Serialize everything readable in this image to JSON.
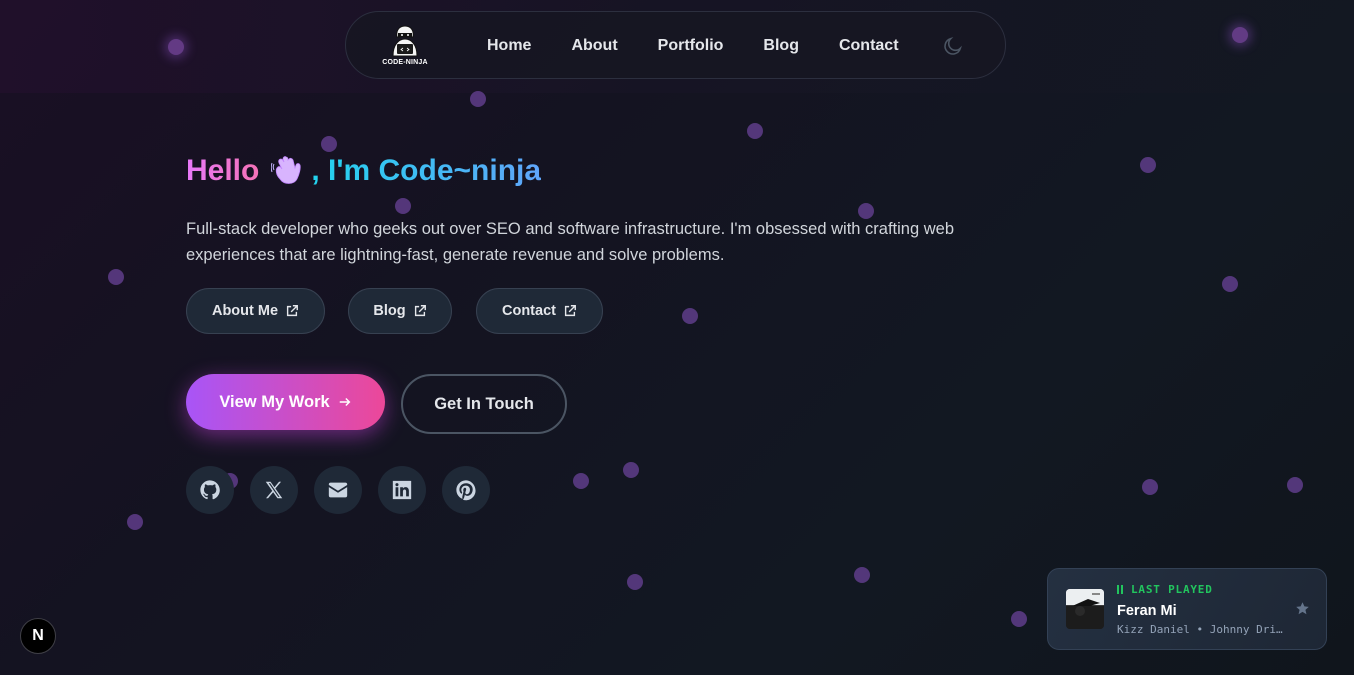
{
  "nav": {
    "logo_text": "CODE-NINJA",
    "links": [
      "Home",
      "About",
      "Portfolio",
      "Blog",
      "Contact"
    ],
    "theme_icon": "moon-icon"
  },
  "hero": {
    "greeting": "Hello",
    "greeting_emoji": "waving-hand-icon",
    "name": ", I'm Code~ninja",
    "intro": "Full-stack developer who geeks out over SEO and software infrastructure. I'm obsessed with crafting web experiences that are lightning-fast, generate revenue and solve problems.",
    "quick_links": [
      "About Me",
      "Blog",
      "Contact"
    ],
    "primary_cta": "View My Work",
    "secondary_cta": "Get In Touch",
    "socials": [
      "github-icon",
      "x-icon",
      "mail-icon",
      "linkedin-icon",
      "pinterest-icon"
    ]
  },
  "badge": {
    "letter": "N"
  },
  "player": {
    "label": "LAST PLAYED",
    "song": "Feran Mi",
    "artist": "Kizz Daniel • Johnny Drille"
  },
  "colors": {
    "accent_pink": "#ec4899",
    "accent_purple": "#a855f7",
    "accent_cyan": "#22d3ee",
    "player_green": "#22c55e"
  }
}
